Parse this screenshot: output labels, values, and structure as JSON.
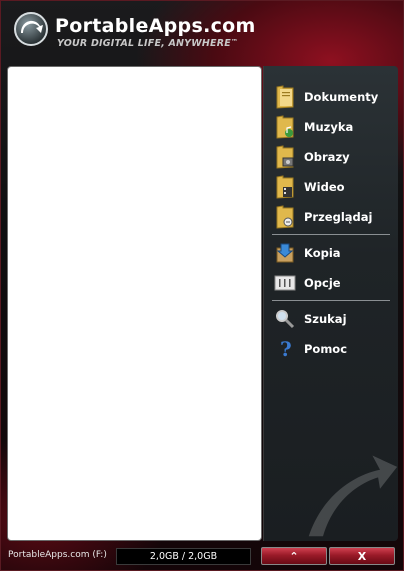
{
  "header": {
    "brand": "PortableApps.com",
    "tagline": "YOUR DIGITAL LIFE, ANYWHERE",
    "trademark": "™"
  },
  "menu": {
    "items": [
      {
        "label": "Dokumenty",
        "icon": "documents-folder-icon"
      },
      {
        "label": "Muzyka",
        "icon": "music-folder-icon"
      },
      {
        "label": "Obrazy",
        "icon": "pictures-folder-icon"
      },
      {
        "label": "Wideo",
        "icon": "video-folder-icon"
      },
      {
        "label": "Przeglądaj",
        "icon": "explore-folder-icon"
      },
      {
        "label": "Kopia",
        "icon": "backup-icon"
      },
      {
        "label": "Opcje",
        "icon": "options-icon"
      },
      {
        "label": "Szukaj",
        "icon": "search-icon"
      },
      {
        "label": "Pomoc",
        "icon": "help-icon"
      }
    ]
  },
  "footer": {
    "drive_label": "PortableApps.com (F:)",
    "storage": "2,0GB / 2,0GB",
    "minimize_label": "⌃",
    "close_label": "X"
  },
  "colors": {
    "accent": "#9a1a28",
    "sidebar": "#1f2427"
  }
}
